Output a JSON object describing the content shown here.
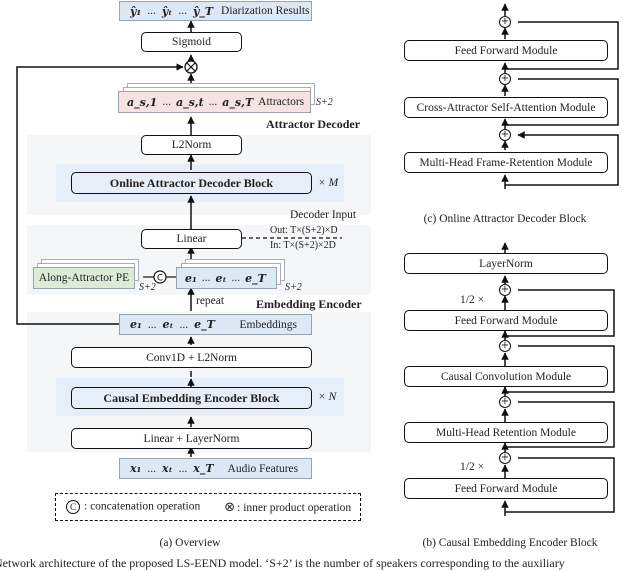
{
  "overview": {
    "output": {
      "tokens": [
        "ŷ₁",
        "...",
        "ŷₜ",
        "...",
        "ŷ_T"
      ],
      "label": "Diarization Results"
    },
    "sigmoid": "Sigmoid",
    "attractors": {
      "tokens": [
        "a_s,1",
        "...",
        "a_s,t",
        "...",
        "a_s,T"
      ],
      "label": "Attractors",
      "stack_label": "S+2"
    },
    "attractor_decoder_title": "Attractor Decoder",
    "l2norm": "L2Norm",
    "decoder_block": "Online Attractor Decoder Block",
    "decoder_repeat": "× M",
    "decoder_input_title": "Decoder Input",
    "linear": "Linear",
    "linear_out": "Out: T×(S+2)×D",
    "linear_in": "In: T×(S+2)×2D",
    "pe": {
      "label": "Along-Attractor PE",
      "stack_label": "S+2"
    },
    "repeated_embeddings": {
      "tokens": [
        "e₁",
        "...",
        "eₜ",
        "...",
        "e_T"
      ],
      "stack_label": "S+2"
    },
    "repeat_label": "repeat",
    "embedding_encoder_title": "Embedding Encoder",
    "embeddings": {
      "tokens": [
        "e₁",
        "...",
        "eₜ",
        "...",
        "e_T"
      ],
      "label": "Embeddings"
    },
    "conv": "Conv1D + L2Norm",
    "encoder_block": "Causal Embedding Encoder Block",
    "encoder_repeat": "× N",
    "linear_ln": "Linear + LayerNorm",
    "audio": {
      "tokens": [
        "x₁",
        "...",
        "xₜ",
        "...",
        "x_T"
      ],
      "label": "Audio Features"
    },
    "legend": {
      "concat": ": concatenation operation",
      "inner": ": inner product operation",
      "concat_symbol": "C",
      "inner_symbol": "⊗"
    },
    "caption": "(a) Overview"
  },
  "decoder_block": {
    "modules": [
      "Feed Forward Module",
      "Cross-Attractor Self-Attention Module",
      "Multi-Head Frame-Retention Module"
    ],
    "caption": "(c) Online Attractor Decoder Block"
  },
  "encoder_block": {
    "modules": [
      "LayerNorm",
      "Feed Forward Module",
      "Causal Convolution Module",
      "Multi-Head Retention Module",
      "Feed Forward Module"
    ],
    "half_label": "1/2 ×",
    "caption": "(b) Causal Embedding Encoder Block"
  },
  "figure_caption": "Network architecture of the proposed LS-EEND model. ‘S+2’ is the number of speakers corresponding to the auxiliary"
}
